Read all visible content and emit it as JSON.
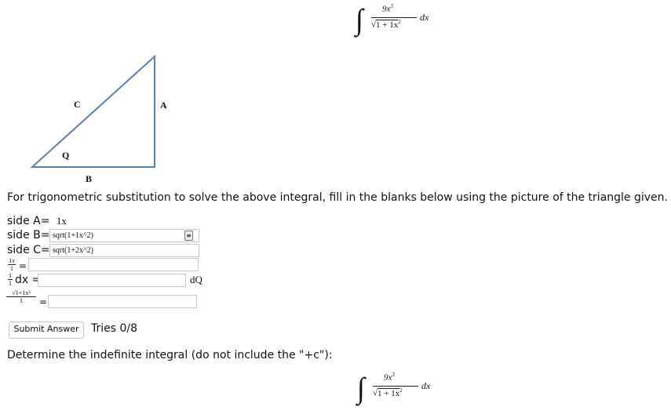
{
  "integral_top": {
    "numerator": "9x",
    "numerator_power": "3",
    "den_prefix": "√",
    "den_body": "1 + 1x",
    "den_power": "2",
    "dx": "dx"
  },
  "triangle": {
    "label_c": "C",
    "label_a": "A",
    "label_q": "Q",
    "label_b": "B",
    "stroke_color": "#5b7fae"
  },
  "problem_text": "For trigonometric substitution to solve the above integral, fill in the blanks below using the picture of the triangle given.",
  "side_a": {
    "label": "side A=",
    "value": "1x"
  },
  "side_b": {
    "label": "side B=",
    "value": "sqrt(1+1x^2)"
  },
  "side_c": {
    "label": "side C=",
    "value": "sqrt(1+2x^2)"
  },
  "ratio1": {
    "num": "1x",
    "den": "1",
    "eq": "=",
    "value": ""
  },
  "ratio2": {
    "num": "1",
    "den": "1",
    "dx_label": "dx =",
    "value": "",
    "suffix": "dQ"
  },
  "ratio3": {
    "num": "√1+1x²",
    "den": "1",
    "eq": "=",
    "value": ""
  },
  "submit": {
    "label": "Submit Answer"
  },
  "tries": "Tries 0/8",
  "determine_text": "Determine the indefinite integral (do not include the \"+c\"):",
  "integral_bottom": {
    "numerator": "9x",
    "numerator_power": "3",
    "den_prefix": "√",
    "den_body": "1 + 1x",
    "den_power": "2",
    "dx": "dx"
  }
}
